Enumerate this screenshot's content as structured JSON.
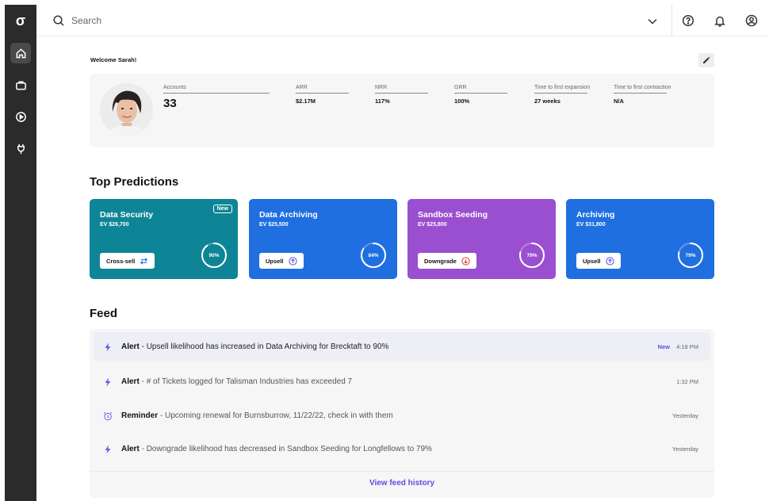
{
  "app": {
    "logo": "σ",
    "nav": [
      "home-icon",
      "briefcase-icon",
      "play-icon",
      "plug-icon"
    ]
  },
  "search": {
    "placeholder": "Search"
  },
  "header": {
    "icons": [
      "help-icon",
      "bell-icon",
      "account-icon"
    ]
  },
  "welcome": "Welcome Sarah!",
  "stats": {
    "accounts": {
      "label": "Accounts",
      "value": "33"
    },
    "arr": {
      "label": "ARR",
      "value": "$2.17M"
    },
    "nrr": {
      "label": "NRR",
      "value": "117%"
    },
    "grr": {
      "label": "GRR",
      "value": "100%"
    },
    "tfe": {
      "label": "Time to first expansion",
      "value": "27 weeks"
    },
    "tfc": {
      "label": "Time to first contraction",
      "value": "N/A"
    }
  },
  "predictions": {
    "title": "Top Predictions",
    "cards": [
      {
        "title": "Data Security",
        "ev": "EV $26,700",
        "action": "Cross-sell",
        "pct": "90%",
        "pct_value": 0.9,
        "color": "#0e8597",
        "badge": "New",
        "action_icon": "swap-icon"
      },
      {
        "title": "Data Archiving",
        "ev": "EV $25,500",
        "action": "Upsell",
        "pct": "84%",
        "pct_value": 0.84,
        "color": "#1f6fe0",
        "action_icon": "arrow-up-circle-icon"
      },
      {
        "title": "Sandbox Seeding",
        "ev": "EV $25,800",
        "action": "Downgrade",
        "pct": "79%",
        "pct_value": 0.79,
        "color": "#9a4fd0",
        "action_icon": "arrow-down-circle-icon"
      },
      {
        "title": "Archiving",
        "ev": "EV $31,800",
        "action": "Upsell",
        "pct": "79%",
        "pct_value": 0.79,
        "color": "#1f6fe0",
        "action_icon": "arrow-up-circle-icon"
      }
    ]
  },
  "feed": {
    "title": "Feed",
    "items": [
      {
        "kind": "Alert",
        "text": "Upsell likelihood has increased in Data Archiving for Brecktaft to 90%",
        "time": "4:18 PM",
        "new": "New",
        "icon": "bolt-icon"
      },
      {
        "kind": "Alert",
        "text": "# of Tickets logged for Talisman Industries has exceeded 7",
        "time": "1:32 PM",
        "icon": "bolt-icon"
      },
      {
        "kind": "Reminder",
        "text": "Upcoming renewal for Burnsburrow, 11/22/22, check in with them",
        "time": "Yesterday",
        "icon": "alarm-clock-icon"
      },
      {
        "kind": "Alert",
        "text": "Downgrade likelihood has decreased in Sandbox Seeding for Longfellows to 79%",
        "time": "Yesterday",
        "icon": "bolt-icon"
      }
    ],
    "separator": " - ",
    "history_link": "View feed history"
  },
  "colors": {
    "accent": "#5b4ee0",
    "rail": "#2b2b2b"
  }
}
